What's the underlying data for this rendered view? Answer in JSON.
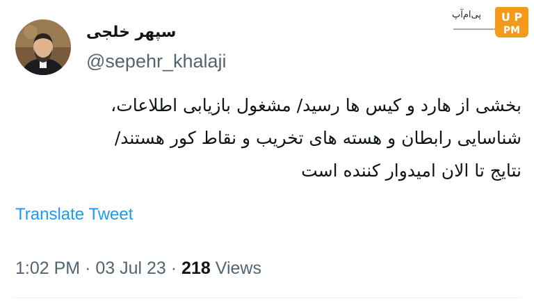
{
  "author": {
    "name": "سپهر خلجی",
    "handle": "@sepehr_khalaji"
  },
  "watermark": {
    "text": "پی‌ام‌آپ",
    "badge": "UPM"
  },
  "tweet": {
    "lines": [
      "بخشی از هارد و کیس ها رسید/ مشغول بازیابی اطلاعات،",
      "شناسایی رابطان و هسته های تخریب و نقاط کور هستند/",
      "نتایج تا الان امیدوار کننده است"
    ]
  },
  "translate_label": "Translate Tweet",
  "meta": {
    "time": "1:02 PM",
    "sep1": "·",
    "date": "03 Jul 23",
    "sep2": "·",
    "views_count": "218",
    "views_label": "Views"
  },
  "colors": {
    "link": "#1d9bf0",
    "secondary_text": "#536471",
    "primary_text": "#0f1419",
    "logo_orange": "#f39a1b"
  }
}
